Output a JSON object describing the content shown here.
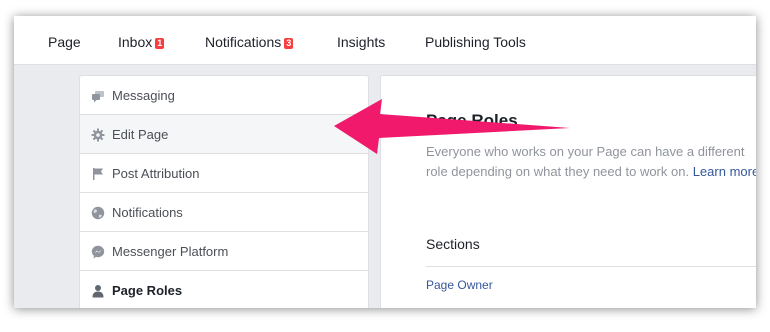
{
  "topnav": {
    "tabs": [
      {
        "label": "Page"
      },
      {
        "label": "Inbox",
        "badge": "1"
      },
      {
        "label": "Notifications",
        "badge": "3"
      },
      {
        "label": "Insights"
      },
      {
        "label": "Publishing Tools"
      }
    ]
  },
  "menu": {
    "items": [
      {
        "label": "Messaging",
        "icon": "chat-bubbles-icon"
      },
      {
        "label": "Edit Page",
        "icon": "gear-icon"
      },
      {
        "label": "Post Attribution",
        "icon": "flag-icon"
      },
      {
        "label": "Notifications",
        "icon": "globe-icon"
      },
      {
        "label": "Messenger Platform",
        "icon": "messenger-icon"
      },
      {
        "label": "Page Roles",
        "icon": "person-icon"
      }
    ]
  },
  "content": {
    "title": "Page Roles",
    "description": "Everyone who works on your Page can have a different role depending on what they need to work on.",
    "learn_more": "Learn more",
    "sections_heading": "Sections",
    "page_owner": "Page Owner"
  },
  "colors": {
    "badge": "#fa3e3e",
    "link": "#365899",
    "arrow": "#f0196b",
    "background": "#e9ebee"
  }
}
